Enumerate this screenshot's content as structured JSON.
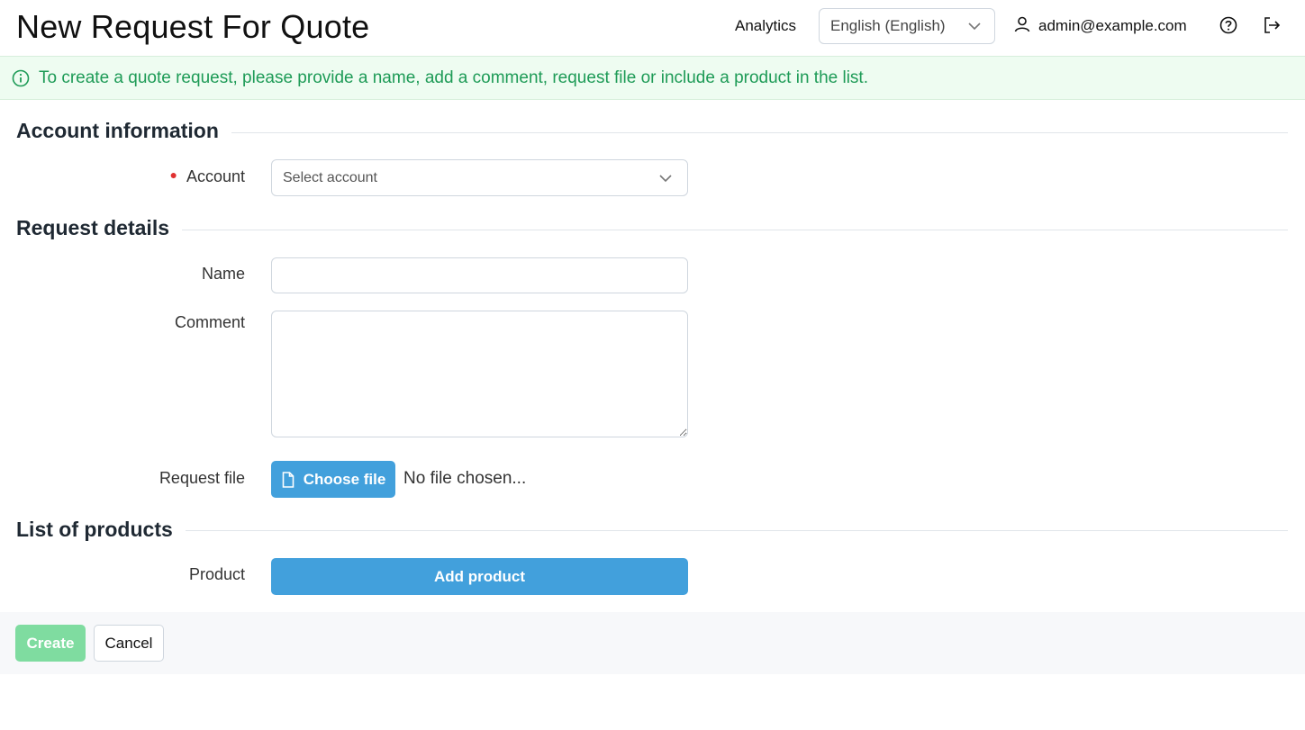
{
  "header": {
    "title": "New Request For Quote",
    "analytics_label": "Analytics",
    "language_value": "English (English)",
    "user_email": "admin@example.com"
  },
  "banner": {
    "text": "To create a quote request, please provide a name, add a comment, request file or include a product in the list."
  },
  "sections": {
    "account_info": "Account information",
    "request_details": "Request details",
    "products": "List of products"
  },
  "form": {
    "account_label": "Account",
    "account_placeholder": "Select account",
    "name_label": "Name",
    "name_value": "",
    "comment_label": "Comment",
    "comment_value": "",
    "request_file_label": "Request file",
    "choose_file_label": "Choose file",
    "no_file_text": "No file chosen...",
    "product_label": "Product",
    "add_product_label": "Add product"
  },
  "footer": {
    "create_label": "Create",
    "cancel_label": "Cancel"
  },
  "colors": {
    "primary": "#42a0dc",
    "success_disabled": "#7fdca0",
    "banner_bg": "#eefcf1",
    "banner_text": "#1e9b57",
    "required": "#e03131"
  },
  "icons": {
    "language_chevron": "chevron-down-icon",
    "user": "user-icon",
    "help": "help-circle-icon",
    "logout": "logout-icon",
    "info": "info-circle-icon",
    "file": "file-icon"
  }
}
